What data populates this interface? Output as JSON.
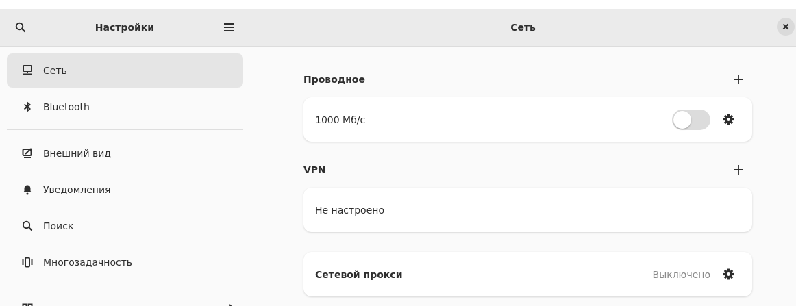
{
  "sidebar": {
    "title": "Настройки",
    "groups": [
      [
        {
          "label": "Сеть",
          "selected": true
        },
        {
          "label": "Bluetooth",
          "selected": false
        }
      ],
      [
        {
          "label": "Внешний вид",
          "selected": false
        },
        {
          "label": "Уведомления",
          "selected": false
        },
        {
          "label": "Поиск",
          "selected": false
        },
        {
          "label": "Многозадачность",
          "selected": false
        }
      ],
      [
        {
          "selected": false,
          "chevron": true
        }
      ]
    ]
  },
  "main": {
    "title": "Сеть",
    "sections": [
      {
        "title": "Проводное",
        "add": true,
        "rows": [
          {
            "label": "1000 Мб/с",
            "toggle": {
              "on": false
            },
            "settings": true
          }
        ]
      },
      {
        "title": "VPN",
        "add": true,
        "rows": [
          {
            "label": "Не настроено"
          }
        ]
      },
      {
        "rows": [
          {
            "label": "Сетевой прокси",
            "bold": true,
            "value": "Выключено",
            "settings": true
          }
        ]
      }
    ]
  }
}
